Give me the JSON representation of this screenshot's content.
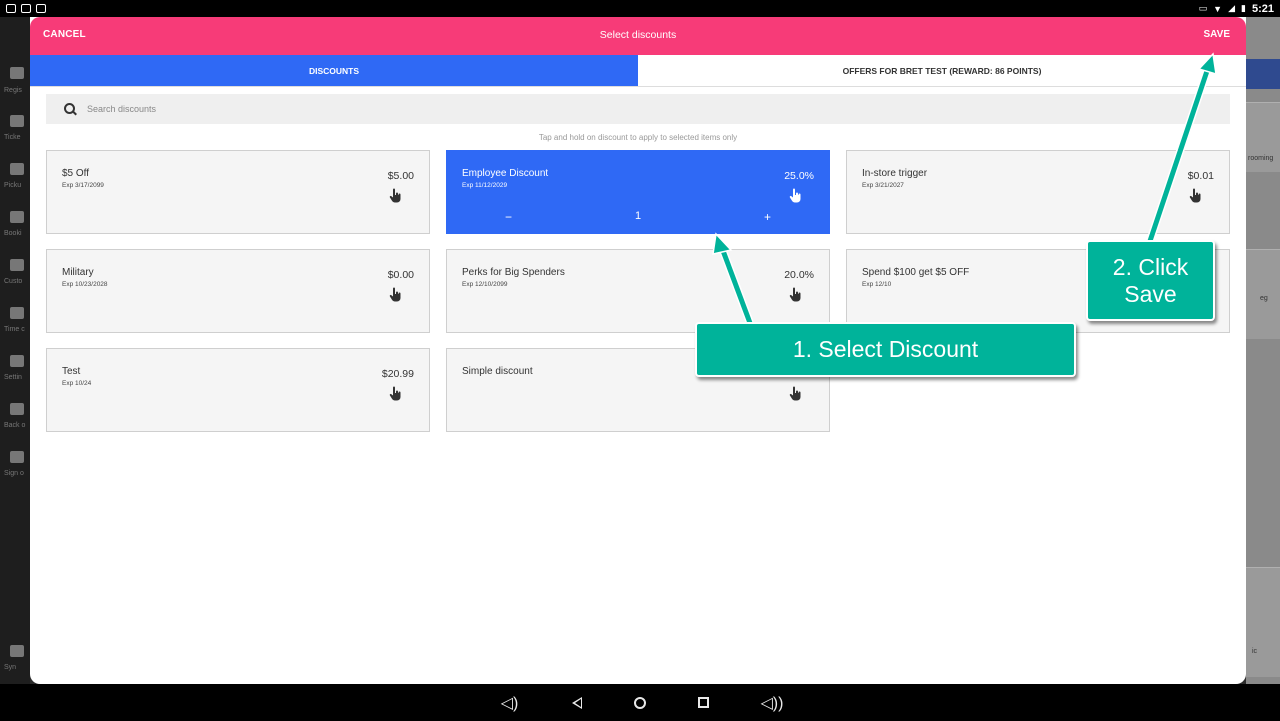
{
  "status_bar": {
    "time": "5:21"
  },
  "background_app": {
    "sidebar": [
      {
        "label": "Regis"
      },
      {
        "label": "Ticke"
      },
      {
        "label": "Picku"
      },
      {
        "label": "Booki"
      },
      {
        "label": "Custo"
      },
      {
        "label": "Time c"
      },
      {
        "label": "Settin"
      },
      {
        "label": "Back o"
      },
      {
        "label": "Sign o"
      },
      {
        "label": "Syn"
      }
    ],
    "right_fragments": [
      "rooming",
      "eg",
      "ic"
    ]
  },
  "dialog": {
    "cancel_label": "CANCEL",
    "title": "Select discounts",
    "save_label": "SAVE",
    "tabs": [
      {
        "label": "DISCOUNTS",
        "active": true
      },
      {
        "label": "OFFERS FOR BRET TEST (REWARD: 86 POINTS)",
        "active": false
      }
    ],
    "search": {
      "placeholder": "Search discounts"
    },
    "hint": "Tap and hold on discount to apply to selected items only",
    "discounts": [
      {
        "name": "$5 Off",
        "exp": "Exp 3/17/2099",
        "value": "$5.00",
        "selected": false
      },
      {
        "name": "Employee Discount",
        "exp": "Exp 11/12/2029",
        "value": "25.0%",
        "selected": true,
        "quantity": "1",
        "minus": "−",
        "plus": "+"
      },
      {
        "name": "In-store trigger",
        "exp": "Exp 3/21/2027",
        "value": "$0.01",
        "selected": false
      },
      {
        "name": "Military",
        "exp": "Exp 10/23/2028",
        "value": "$0.00",
        "selected": false
      },
      {
        "name": "Perks for Big Spenders",
        "exp": "Exp 12/10/2099",
        "value": "20.0%",
        "selected": false
      },
      {
        "name": "Spend $100 get $5 OFF",
        "exp": "Exp 12/10",
        "value": "",
        "selected": false
      },
      {
        "name": "Test",
        "exp": "Exp 10/24",
        "value": "$20.99",
        "selected": false
      },
      {
        "name": "Simple discount",
        "exp": "",
        "value": "",
        "selected": false
      }
    ]
  },
  "callouts": [
    {
      "text": "1. Select Discount"
    },
    {
      "line1": "2. Click",
      "line2": "Save"
    }
  ],
  "colors": {
    "header": "#f73b78",
    "active_tab": "#2f69f5",
    "callout": "#00b39a"
  }
}
